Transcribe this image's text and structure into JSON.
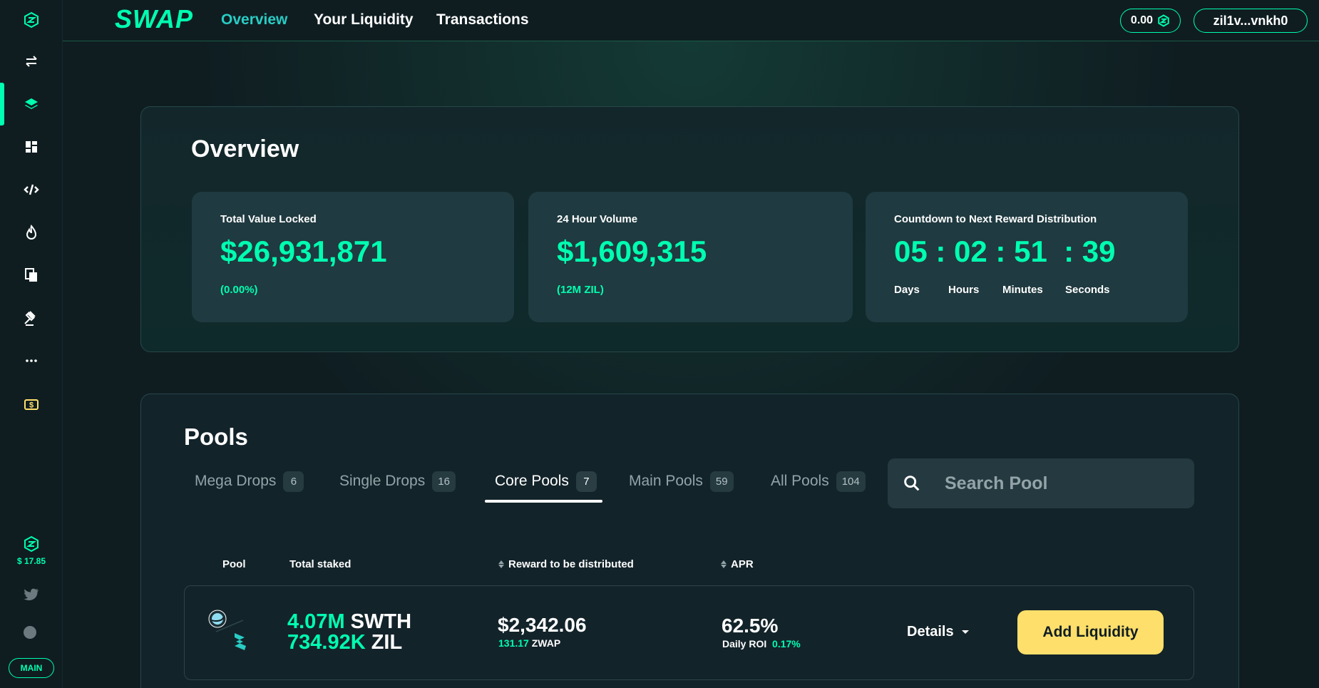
{
  "header": {
    "logo": "SWAP",
    "nav": [
      "Overview",
      "Your Liquidity",
      "Transactions"
    ],
    "balance": "0.00",
    "wallet": "zil1v...vnkh0"
  },
  "sidebar": {
    "icons": [
      "zilswap-logo-icon",
      "swap-arrows-icon",
      "layers-icon",
      "dashboard-icon",
      "bridge-icon",
      "flame-icon",
      "pages-icon",
      "gavel-icon",
      "more-icon",
      "dollar-icon"
    ],
    "price": "$ 17.85",
    "network": "MAIN"
  },
  "overview": {
    "title": "Overview",
    "tvl": {
      "label": "Total Value Locked",
      "value": "$26,931,871",
      "sub": "(0.00%)"
    },
    "volume": {
      "label": "24 Hour Volume",
      "value": "$1,609,315",
      "sub": "(12M ZIL)"
    },
    "countdown": {
      "label": "Countdown to Next Reward Distribution",
      "value": "05 : 02 : 51  : 39",
      "units": [
        "Days",
        "Hours",
        "Minutes",
        "Seconds"
      ]
    }
  },
  "pools": {
    "title": "Pools",
    "tabs": [
      {
        "label": "Mega Drops",
        "count": "6"
      },
      {
        "label": "Single Drops",
        "count": "16"
      },
      {
        "label": "Core Pools",
        "count": "7"
      },
      {
        "label": "Main Pools",
        "count": "59"
      },
      {
        "label": "All Pools",
        "count": "104"
      }
    ],
    "active_tab": "Core Pools",
    "search_placeholder": "Search Pool",
    "columns": [
      "Pool",
      "Total staked",
      "Reward to be distributed",
      "APR"
    ],
    "rows": [
      {
        "staked_1_amount": "4.07M",
        "staked_1_token": "SWTH",
        "staked_2_amount": "734.92K",
        "staked_2_token": "ZIL",
        "reward": "$2,342.06",
        "reward_sub_amount": "131.17",
        "reward_sub_token": "ZWAP",
        "apr": "62.5%",
        "roi_label": "Daily ROI",
        "roi_value": "0.17%",
        "details_label": "Details",
        "add_label": "Add Liquidity"
      }
    ]
  },
  "colors": {
    "accent": "#00ffb0",
    "button": "#ffdf6b",
    "background": "#0f1d21"
  }
}
